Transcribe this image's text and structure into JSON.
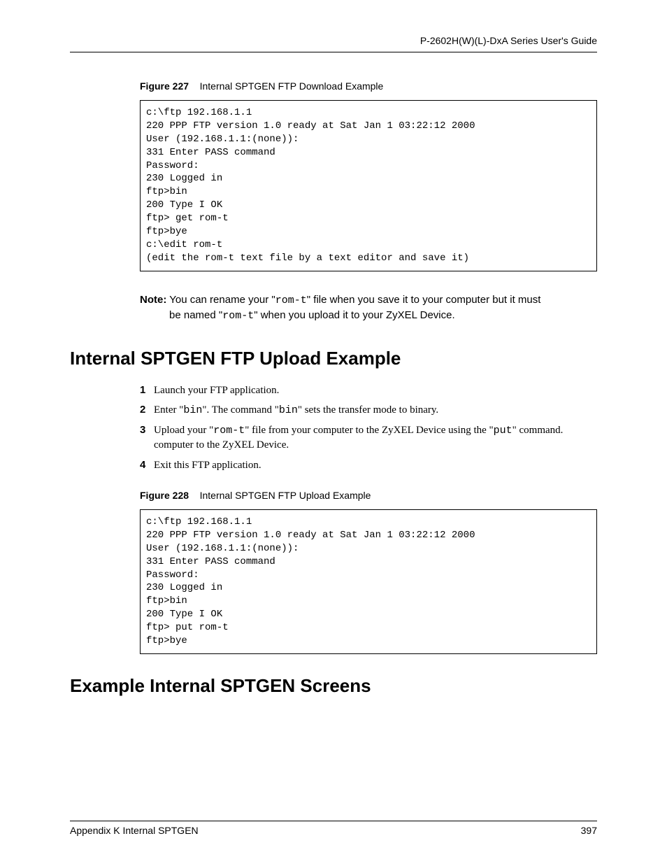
{
  "header": {
    "guide_title": "P-2602H(W)(L)-DxA Series User's Guide"
  },
  "figure227": {
    "label": "Figure 227",
    "title": "Internal SPTGEN FTP Download Example",
    "code": "c:\\ftp 192.168.1.1\n220 PPP FTP version 1.0 ready at Sat Jan 1 03:22:12 2000\nUser (192.168.1.1:(none)):\n331 Enter PASS command\nPassword:\n230 Logged in\nftp>bin\n200 Type I OK\nftp> get rom-t\nftp>bye\nc:\\edit rom-t\n(edit the rom-t text file by a text editor and save it)"
  },
  "note": {
    "label": "Note:",
    "line1_a": " You can rename your \"",
    "line1_code1": "rom-t",
    "line1_b": "\" file when you save it to your computer but it must",
    "line2_a": "be named \"",
    "line2_code1": "rom-t",
    "line2_b": "\" when you upload it to your ZyXEL Device."
  },
  "upload_section": {
    "heading": "Internal SPTGEN FTP Upload Example",
    "items": [
      {
        "num": "1",
        "plain": "Launch your FTP application."
      },
      {
        "num": "2",
        "a": "Enter \"",
        "c1": "bin",
        "b": "\". The command \"",
        "c2": "bin",
        "d": "\" sets the transfer mode to binary."
      },
      {
        "num": "3",
        "a": "Upload your \"",
        "c1": "rom-t",
        "b": "\" file from your computer to the ZyXEL Device using the \"",
        "c2": "put",
        "d": "\" command. computer to the ZyXEL Device."
      },
      {
        "num": "4",
        "plain": "Exit this FTP application."
      }
    ]
  },
  "figure228": {
    "label": "Figure 228",
    "title": "Internal SPTGEN FTP Upload Example",
    "code": "c:\\ftp 192.168.1.1\n220 PPP FTP version 1.0 ready at Sat Jan 1 03:22:12 2000\nUser (192.168.1.1:(none)):\n331 Enter PASS command\nPassword:\n230 Logged in\nftp>bin\n200 Type I OK\nftp> put rom-t\nftp>bye"
  },
  "screens_section": {
    "heading": "Example Internal SPTGEN Screens"
  },
  "footer": {
    "left": "Appendix K Internal SPTGEN",
    "right": "397"
  }
}
